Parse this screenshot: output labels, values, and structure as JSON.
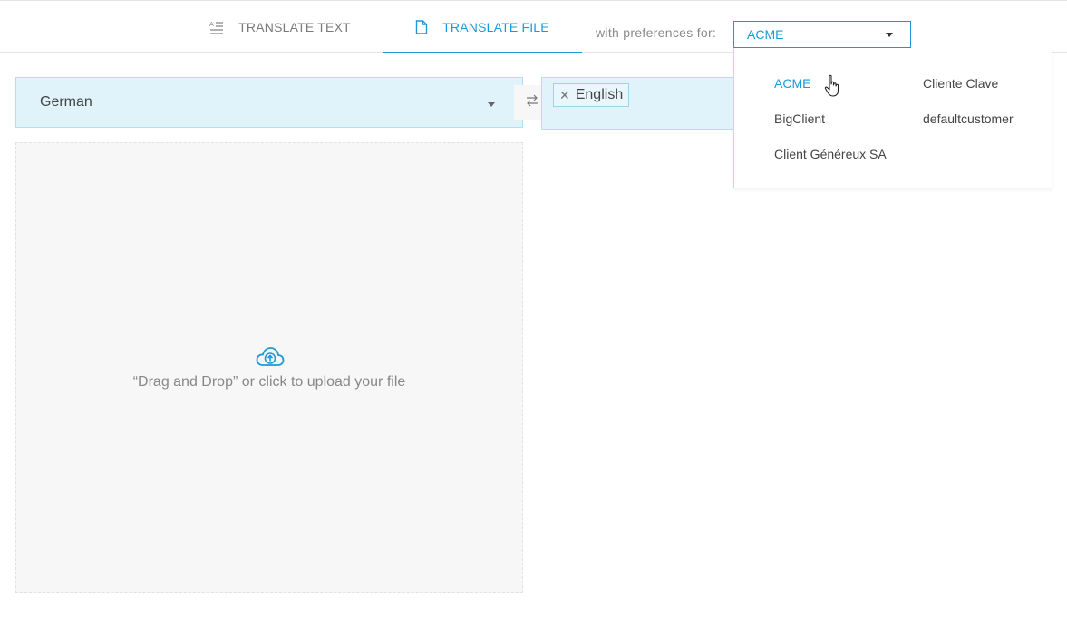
{
  "tabs": [
    {
      "label": "TRANSLATE TEXT",
      "icon": "text-lines-icon",
      "active": false
    },
    {
      "label": "TRANSLATE FILE",
      "icon": "file-icon",
      "active": true
    }
  ],
  "preferences": {
    "label": "with preferences for:",
    "selected": "ACME",
    "options": [
      "ACME",
      "Cliente Clave",
      "BigClient",
      "defaultcustomer",
      "Client Généreux SA"
    ]
  },
  "source_language": {
    "value": "German"
  },
  "target_languages": [
    {
      "value": "English",
      "remove_glyph": "✕"
    }
  ],
  "upload": {
    "text": "“Drag and Drop” or click to upload your file",
    "icon": "cloud-upload-icon"
  },
  "colors": {
    "accent": "#1a9bd6",
    "select_background": "#e0f3fb",
    "dropzone_background": "#f7f7f7"
  }
}
